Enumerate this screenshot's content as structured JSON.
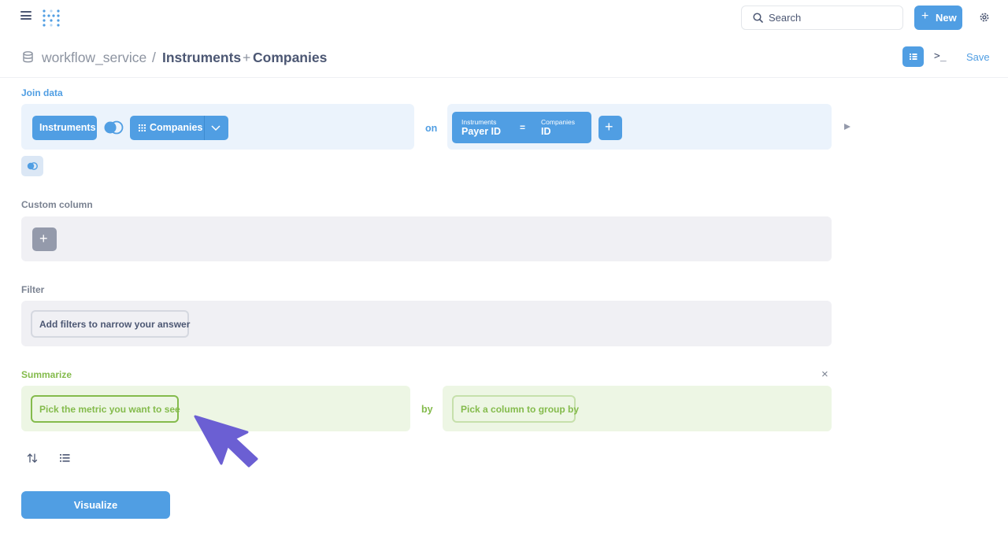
{
  "nav": {
    "search_placeholder": "Search",
    "new_label": "New",
    "new_plus": "+"
  },
  "header": {
    "database": "workflow_service",
    "separator": "/",
    "table": "Instruments",
    "join_plus": "+",
    "joined_table": "Companies",
    "save_label": "Save",
    "console_glyph": ">_"
  },
  "join": {
    "title": "Join data",
    "source_table": "Instruments",
    "target_table": "Companies",
    "on_label": "on",
    "condition": {
      "left_table": "Instruments",
      "left_column": "Payer ID",
      "operator": "=",
      "right_table": "Companies",
      "right_column": "ID"
    },
    "add_condition": "+"
  },
  "custom_column": {
    "title": "Custom column",
    "add": "+"
  },
  "filter": {
    "title": "Filter",
    "button": "Add filters to narrow your answer"
  },
  "summarize": {
    "title": "Summarize",
    "metric_button": "Pick the metric you want to see",
    "by_label": "by",
    "group_button": "Pick a column to group by",
    "close": "×"
  },
  "actions": {
    "visualize": "Visualize"
  },
  "colors": {
    "brand": "#509ee3",
    "summarize": "#84bb4c",
    "cursor": "#6b5fd3"
  }
}
